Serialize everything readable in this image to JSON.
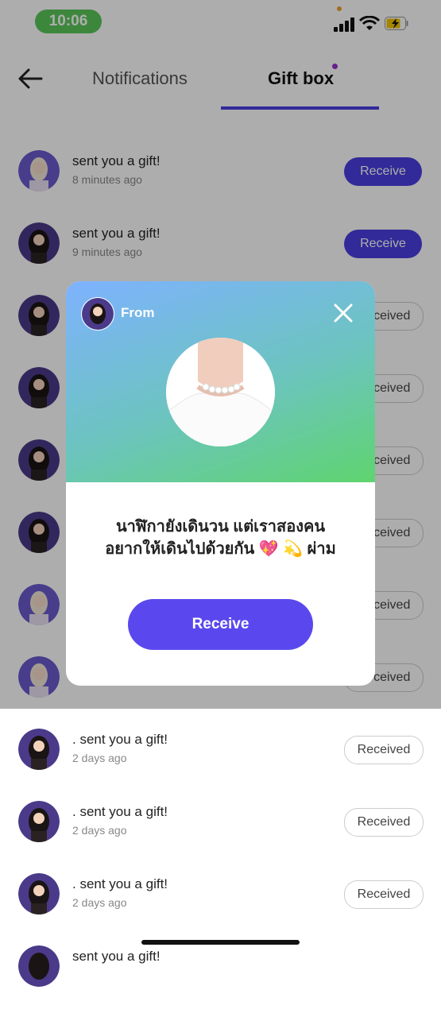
{
  "status": {
    "time": "10:06"
  },
  "header": {
    "tabs": [
      {
        "label": "Notifications"
      },
      {
        "label": "Gift box"
      }
    ]
  },
  "list": {
    "rows": [
      {
        "title": "  sent you a gift!",
        "time": "8 minutes ago",
        "action": "Receive",
        "state": "receive"
      },
      {
        "title": "  sent you a gift!",
        "time": "9 minutes ago",
        "action": "Receive",
        "state": "receive"
      },
      {
        "title": "",
        "time": "",
        "action": "Received",
        "state": "received"
      },
      {
        "title": "",
        "time": "",
        "action": "Received",
        "state": "received"
      },
      {
        "title": "",
        "time": "",
        "action": "Received",
        "state": "received"
      },
      {
        "title": "",
        "time": "",
        "action": "Received",
        "state": "received"
      },
      {
        "title": "",
        "time": "",
        "action": "Received",
        "state": "received"
      },
      {
        "title": "",
        "time": "",
        "action": "Received",
        "state": "received"
      },
      {
        "title": ". sent you a gift!",
        "time": "2 days ago",
        "action": "Received",
        "state": "received"
      },
      {
        "title": ". sent you a gift!",
        "time": "2 days ago",
        "action": "Received",
        "state": "received"
      },
      {
        "title": ". sent you a gift!",
        "time": "2 days ago",
        "action": "Received",
        "state": "received"
      },
      {
        "title": "  sent you a gift!",
        "time": "",
        "action": "",
        "state": "partial"
      }
    ]
  },
  "modal": {
    "from_label": "From",
    "message_line1": "นาฬิกายังเดินวน แต่เราสองคน",
    "message_line2": "อยากให้เดินไปด้วยกัน 💖 💫 ผ่าม",
    "receive_label": "Receive"
  },
  "colors": {
    "accent": "#4a3fe0",
    "modal_button": "#5a48ee",
    "time_pill": "#5ac85a"
  }
}
